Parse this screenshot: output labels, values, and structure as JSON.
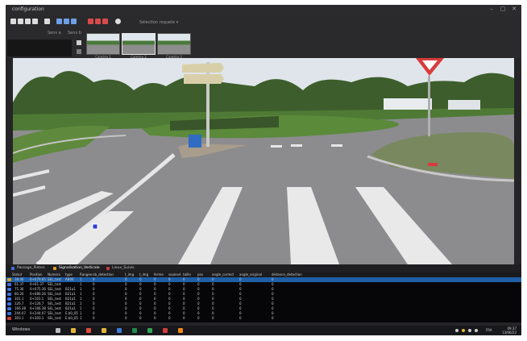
{
  "window": {
    "title": "configuration",
    "controls": [
      "–",
      "▢",
      "✕"
    ]
  },
  "toolbar": {
    "selection_label": "Sélection requete ▾",
    "icons": [
      "grid-icon",
      "grid-icon",
      "grid-icon",
      "grid-icon",
      "save-icon",
      "blue-panel-icon",
      "blue-panel-icon",
      "blue-panel-icon",
      "red-tool-icon",
      "red-tool-icon",
      "red-tool-icon",
      "settings-icon"
    ]
  },
  "strip": {
    "label_a": "Sens a",
    "label_b": "Sens b",
    "thumbnails": [
      {
        "label": "Caméra 1",
        "selected": false
      },
      {
        "label": "Caméra 2",
        "selected": true
      },
      {
        "label": "Caméra 3",
        "selected": false
      }
    ]
  },
  "tabs": [
    {
      "label": "Passage_Pieton",
      "color": "#3d6fe0"
    },
    {
      "label": "Signalisation_Verticale",
      "color": "#e0a020"
    },
    {
      "label": "Lieux_Suivis",
      "color": "#d03a3a"
    }
  ],
  "grid": {
    "columns": [
      "Statut",
      "Position",
      "Numero",
      "type",
      "Rangee",
      "nb_detection",
      "t_img",
      "t_img",
      "ferme",
      "soulevé",
      "taille",
      "pos",
      "angle_correct",
      "angle_original",
      "distance_detection"
    ],
    "rows": [
      [
        "38.46",
        "0+079.95",
        "SEL_test",
        "AB06",
        "1",
        "0",
        "0",
        "0",
        "0",
        "0",
        "0",
        "0",
        "0",
        "0",
        "0"
      ],
      [
        "61.37",
        "0+61.37",
        "SEL_test",
        "",
        "1",
        "0",
        "0",
        "0",
        "0",
        "0",
        "0",
        "0",
        "0",
        "0",
        "0"
      ],
      [
        "75.36",
        "0+075.36",
        "SEL_test",
        "B21a1",
        "1",
        "0",
        "0",
        "0",
        "0",
        "0",
        "0",
        "0",
        "0",
        "0",
        "0"
      ],
      [
        "80.26",
        "0+080.26",
        "SEL_test",
        "B21a1",
        "1",
        "0",
        "0",
        "0",
        "0",
        "0",
        "0",
        "0",
        "0",
        "0",
        "0"
      ],
      [
        "101.1",
        "0+101.1",
        "SEL_test",
        "B21a1",
        "1",
        "0",
        "0",
        "0",
        "0",
        "0",
        "0",
        "0",
        "0",
        "0",
        "0"
      ],
      [
        "126.7",
        "0+126.7",
        "SEL_test",
        "B21a1",
        "1",
        "0",
        "0",
        "0",
        "0",
        "0",
        "0",
        "0",
        "0",
        "0",
        "0"
      ],
      [
        "166.38",
        "0+166.38",
        "SEL_test",
        "B21a1",
        "1",
        "0",
        "0",
        "0",
        "0",
        "0",
        "0",
        "0",
        "0",
        "0",
        "0"
      ],
      [
        "244.07",
        "0+244.07",
        "SEL_test",
        "E.b0_05",
        "1",
        "0",
        "0",
        "0",
        "0",
        "0",
        "0",
        "0",
        "0",
        "0",
        "0"
      ],
      [
        "303.1",
        "0+303.1",
        "SEL_test",
        "E.b0_05",
        "1",
        "0",
        "0",
        "0",
        "0",
        "0",
        "0",
        "0",
        "0",
        "0",
        "0"
      ]
    ],
    "selected_row": 0
  },
  "taskbar": {
    "start_label": "Windows",
    "time": "09:37",
    "date": "13/06/22",
    "language": "FRA",
    "apps": [
      {
        "name": "search-icon",
        "color": "#bbbbbb"
      },
      {
        "name": "file-explorer-icon",
        "color": "#e4b53a"
      },
      {
        "name": "chrome-icon",
        "color": "#e04b3a"
      },
      {
        "name": "folder-icon",
        "color": "#e4b53a"
      },
      {
        "name": "browser-icon",
        "color": "#3b7bd9"
      },
      {
        "name": "excel-icon",
        "color": "#1f8a4c"
      },
      {
        "name": "spreadsheet-icon",
        "color": "#2fa35a"
      },
      {
        "name": "acrobat-icon",
        "color": "#d23a3a"
      },
      {
        "name": "vlc-icon",
        "color": "#f08a1a"
      }
    ]
  },
  "colors": {
    "accent": "#1f5fa6",
    "background": "#252527"
  }
}
